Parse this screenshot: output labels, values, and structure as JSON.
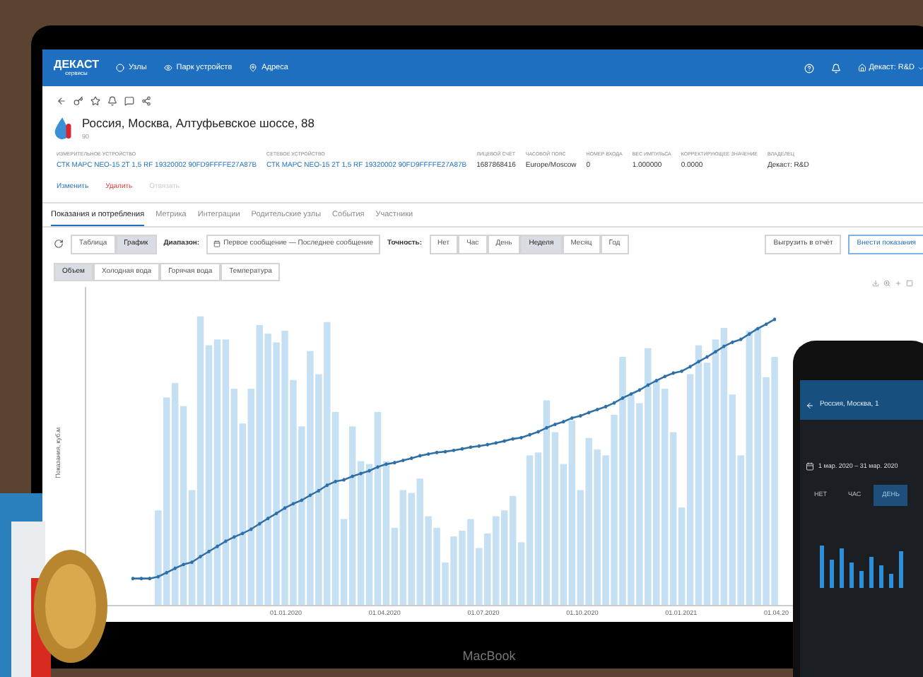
{
  "logo": {
    "name": "ДЕКАСТ",
    "sub": "сервисы"
  },
  "nav": [
    "Узлы",
    "Парк устройств",
    "Адреса"
  ],
  "user": "Декаст: R&D",
  "address": {
    "title": "Россия, Москва, Алтуфьевское шоссе, 88",
    "subtitle": "90"
  },
  "fields": [
    {
      "label": "ИЗМЕРИТЕЛЬНОЕ УСТРОЙСТВО",
      "value": "СТК МАРС NEO-15 2T 1,5 RF 19320002 90FD9FFFFE27A87B",
      "kind": "link"
    },
    {
      "label": "СЕТЕВОЕ УСТРОЙСТВО",
      "value": "СТК МАРС NEO-15 2T 1,5 RF 19320002 90FD9FFFFE27A87B",
      "kind": "link"
    },
    {
      "label": "ЛИЦЕВОЙ СЧЁТ",
      "value": "1687868416",
      "kind": "text"
    },
    {
      "label": "ЧАСОВОЙ ПОЯС",
      "value": "Europe/Moscow",
      "kind": "text"
    },
    {
      "label": "НОМЕР ВХОДА",
      "value": "0",
      "kind": "text"
    },
    {
      "label": "ВЕС ИМПУЛЬСА",
      "value": "1.000000",
      "kind": "text"
    },
    {
      "label": "КОРРЕКТИРУЮЩЕЕ ЗНАЧЕНИЕ",
      "value": "0.0000",
      "kind": "text"
    },
    {
      "label": "ВЛАДЕЛЕЦ",
      "value": "Декаст: R&D",
      "kind": "text"
    }
  ],
  "actions": [
    {
      "label": "Изменить",
      "kind": "primary",
      "disabled": false
    },
    {
      "label": "Удалить",
      "kind": "danger",
      "disabled": false
    },
    {
      "label": "Отвязать",
      "disabled": true
    }
  ],
  "tabs": [
    {
      "label": "Показания и потребления",
      "selected": true
    },
    {
      "label": "Метрика",
      "selected": false
    },
    {
      "label": "Интеграции",
      "selected": false
    },
    {
      "label": "Родительские узлы",
      "selected": false
    },
    {
      "label": "События",
      "selected": false
    },
    {
      "label": "Участники",
      "selected": false
    }
  ],
  "view_modes": [
    {
      "label": "Таблица",
      "selected": false
    },
    {
      "label": "График",
      "selected": true
    }
  ],
  "range": {
    "label": "Диапазон:",
    "value": "Первое сообщение — Последнее сообщение"
  },
  "precision": {
    "label": "Точность:",
    "options": [
      {
        "label": "Нет",
        "selected": false
      },
      {
        "label": "Час",
        "selected": false
      },
      {
        "label": "День",
        "selected": false
      },
      {
        "label": "Неделя",
        "selected": true
      },
      {
        "label": "Месяц",
        "selected": false
      },
      {
        "label": "Год",
        "selected": false
      }
    ]
  },
  "buttons": [
    {
      "label": "Выгрузить в отчёт",
      "kind": "default"
    },
    {
      "label": "Внести показания",
      "kind": "primary"
    }
  ],
  "series_tabs": [
    {
      "label": "Объем",
      "selected": true
    },
    {
      "label": "Холодная вода",
      "selected": false
    },
    {
      "label": "Горячая вода",
      "selected": false
    },
    {
      "label": "Температура",
      "selected": false
    }
  ],
  "chart": {
    "ylabel": "Показания, куб.м",
    "x_labels": [
      "01.01.2020",
      "01.04.2020",
      "01.07.2020",
      "01.10.2020",
      "01.01.2021",
      "01.04.20"
    ]
  },
  "laptop_label": "MacBook",
  "phone": {
    "title": "Россия, Москва, 1",
    "range": "1 мар. 2020 – 31 мар. 2020",
    "options": [
      {
        "label": "НЕТ",
        "selected": false
      },
      {
        "label": "ЧАС",
        "selected": false
      },
      {
        "label": "ДЕНЬ",
        "selected": true
      }
    ]
  }
}
